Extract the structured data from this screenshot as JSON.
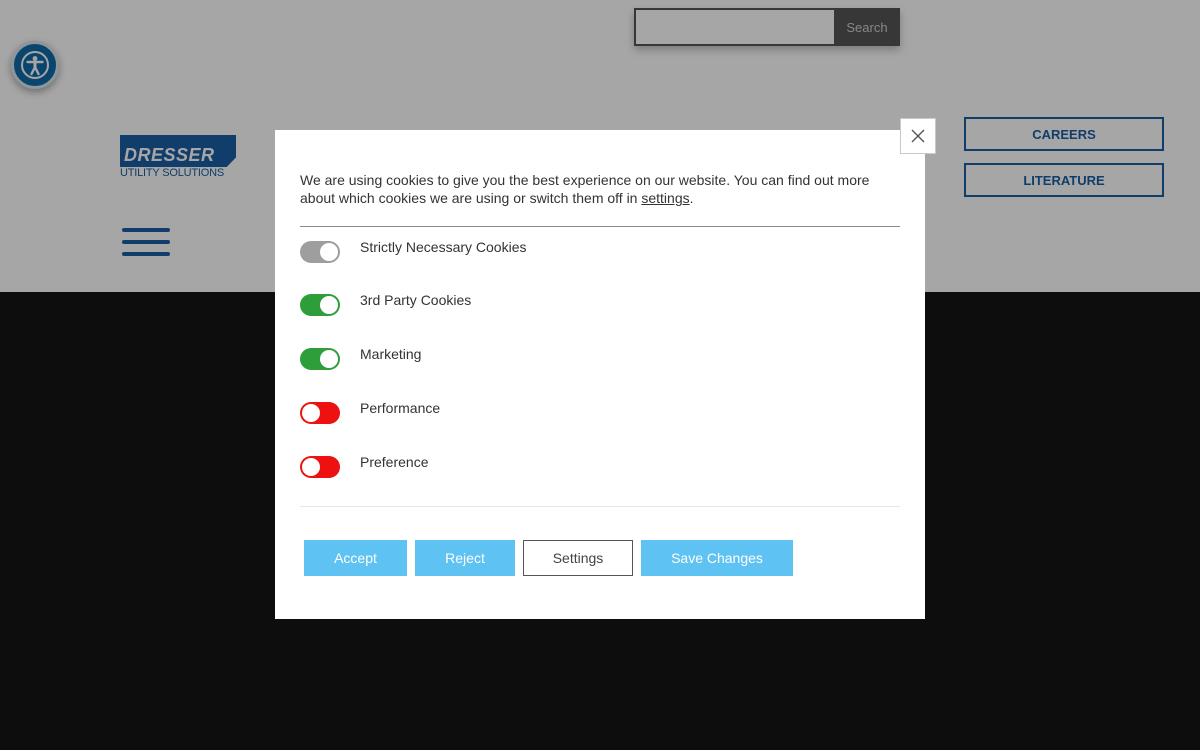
{
  "header": {
    "search": {
      "placeholder": "",
      "button_label": "Search"
    },
    "logo": {
      "word": "DRESSER",
      "subtitle": "UTILITY SOLUTIONS",
      "color": "#1a5fa3"
    },
    "nav": [
      {
        "label": "CAREERS"
      },
      {
        "label": "LITERATURE"
      }
    ],
    "menu_icon": "hamburger-icon",
    "accessibility_icon": "accessibility-icon"
  },
  "cookie_modal": {
    "intro_text": "We are using cookies to give you the best experience on our website. You can find out more about which cookies we are using or switch them off in ",
    "intro_link": "settings",
    "intro_end": ".",
    "close_icon": "close-icon",
    "rows": [
      {
        "label": "Strictly Necessary Cookies",
        "state": "on",
        "color": "#9e9e9e"
      },
      {
        "label": "3rd Party Cookies",
        "state": "on",
        "color": "#2e9e3b"
      },
      {
        "label": "Marketing",
        "state": "on",
        "color": "#2e9e3b"
      },
      {
        "label": "Performance",
        "state": "off",
        "color": "#ee1111"
      },
      {
        "label": "Preference",
        "state": "off",
        "color": "#ee1111"
      }
    ],
    "buttons": {
      "accept": "Accept",
      "reject": "Reject",
      "settings": "Settings",
      "save": "Save Changes"
    },
    "accent_color": "#5ec3f2"
  }
}
